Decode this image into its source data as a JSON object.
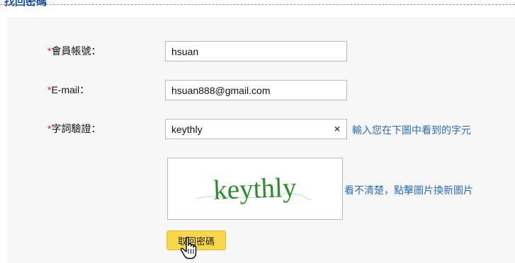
{
  "section": {
    "title": "找回密碼"
  },
  "form": {
    "required_mark": "*",
    "account": {
      "label": "會員帳號：",
      "value": "hsuan"
    },
    "email": {
      "label": "E-mail：",
      "value": "hsuan888@gmail.com"
    },
    "captcha": {
      "label": "字詞驗證：",
      "value": "keythly",
      "clear_symbol": "×",
      "hint": "輸入您在下圖中看到的字元",
      "image_text": "keythly",
      "refresh_hint": "看不清楚，點擊圖片換新圖片"
    },
    "submit_label": "取回密碼"
  },
  "colors": {
    "required": "#e02020",
    "link": "#2a6ebb",
    "captcha_text": "#2e8b2e",
    "button": "#f9d74a"
  },
  "icons": [
    "close-icon",
    "hand-pointer-cursor-icon"
  ]
}
